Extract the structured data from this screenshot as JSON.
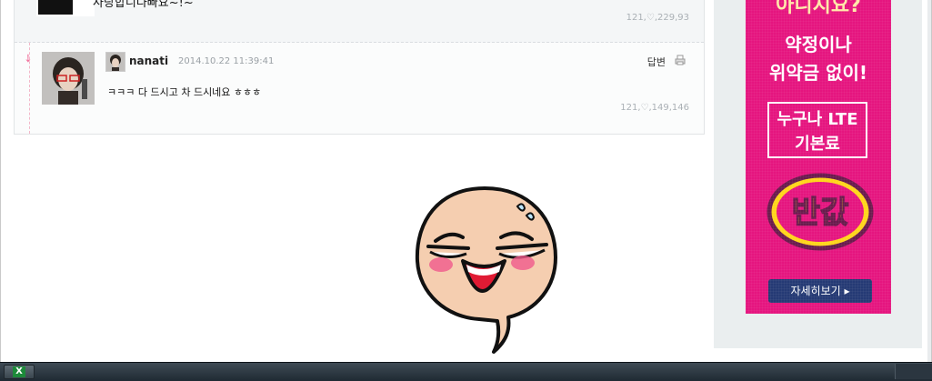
{
  "previous_comment": {
    "text": "사랑합니다빠요~!~",
    "meta": "121,♡,229,93"
  },
  "reply": {
    "username": "nanati",
    "timestamp": "2014.10.22 11:39:41",
    "reply_label": "답변",
    "text": "ㅋㅋㅋ 다 드시고 차 드시네요 ㅎㅎㅎ",
    "meta": "121,♡,149,146"
  },
  "ad": {
    "top_text": "아니지요?",
    "line2": "약정이나",
    "line3": "위약금 없이!",
    "box_line1": "누구나 LTE",
    "box_line2": "기본료",
    "badge_text": "반값",
    "button_label": "자세히보기 ▸"
  },
  "taskbar": {
    "app_icon_label": "X"
  },
  "colors": {
    "ad_pink": "#e5157f",
    "ad_button": "#253a75",
    "badge_yellow": "#ffd51a"
  }
}
